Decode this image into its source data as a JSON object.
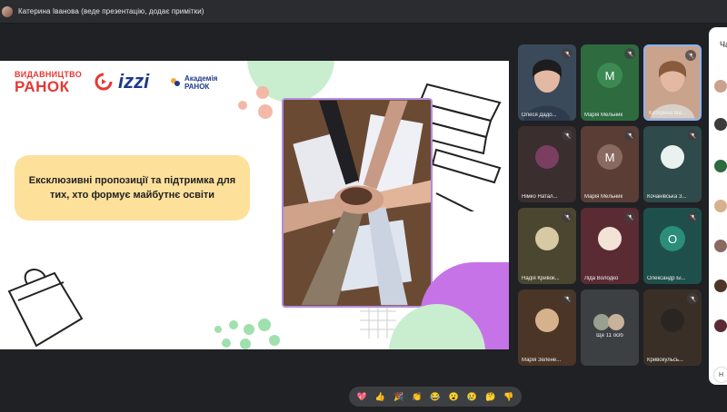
{
  "presenter_bar": {
    "text": "Катерина Іванова (веде презентацію, додає примітки)"
  },
  "slide": {
    "logo_ranok_top": "ВИДАВНИЦТВО",
    "logo_ranok_bottom": "РАНОК",
    "logo_izzi": "izzi",
    "logo_akademia_1": "Академія",
    "logo_akademia_2": "РАНОК",
    "headline": "Ексклюзивні пропозиції та підтримка для тих, хто формує майбутнє освіти"
  },
  "participants": [
    {
      "name": "Олеся Дадо...",
      "kind": "photo",
      "bg": "#3b4a5a"
    },
    {
      "name": "Марія Мельник",
      "kind": "letter",
      "letter": "М",
      "bg": "#2e6b3f",
      "circle": "#3c8a52"
    },
    {
      "name": "Катерина Іва...",
      "kind": "photo",
      "bg": "#c9a38c",
      "active": true
    },
    {
      "name": "Німко Натал...",
      "kind": "avatar",
      "bg": "#3a2e2e",
      "circle": "#7a3e60"
    },
    {
      "name": "Марія Мельник",
      "kind": "letter",
      "letter": "М",
      "bg": "#5a3e36",
      "circle": "#8a6a60"
    },
    {
      "name": "Кочанівська З...",
      "kind": "avatar",
      "bg": "#2f4a4a",
      "circle": "#e9f2ef"
    },
    {
      "name": "Надія Кривок...",
      "kind": "avatar",
      "bg": "#4b4630",
      "circle": "#d7c9a3"
    },
    {
      "name": "Ліда Володко",
      "kind": "avatar",
      "bg": "#5b2b33",
      "circle": "#f3e2d6"
    },
    {
      "name": "Олександр Бі...",
      "kind": "letter",
      "letter": "О",
      "bg": "#1f4f4b",
      "circle": "#2b8d7a"
    },
    {
      "name": "Марія Зелене...",
      "kind": "avatar",
      "bg": "#4a3526",
      "circle": "#d6b28c"
    },
    {
      "name": "Ще 11 осіб",
      "kind": "more",
      "bg": "#3c4043"
    },
    {
      "name": "Кривокульсь...",
      "kind": "avatar",
      "bg": "#3a2f27",
      "circle": "#2a2520"
    }
  ],
  "chat": {
    "title": "Ча",
    "more_label": "Н"
  },
  "reactions": [
    "💖",
    "👍",
    "🎉",
    "👏",
    "😂",
    "😮",
    "😢",
    "🤔",
    "👎"
  ]
}
